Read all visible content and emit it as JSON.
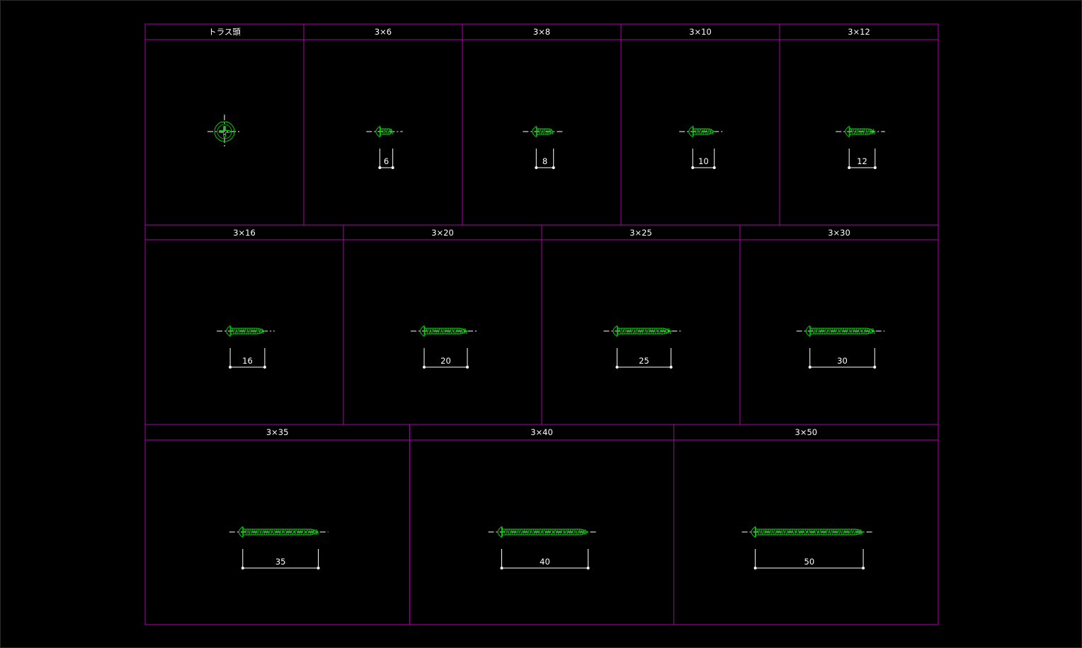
{
  "colors": {
    "background": "#000000",
    "grid": "#b000b0",
    "screw": "#00d000",
    "dimension": "#ffffff",
    "centerline": "#ffffff"
  },
  "title": "トラス頭",
  "rows": [
    {
      "cells": [
        {
          "label": "トラス頭",
          "type": "head-view"
        },
        {
          "label": "3×6",
          "length": 6,
          "dim": "6"
        },
        {
          "label": "3×8",
          "length": 8,
          "dim": "8"
        },
        {
          "label": "3×10",
          "length": 10,
          "dim": "10"
        },
        {
          "label": "3×12",
          "length": 12,
          "dim": "12"
        }
      ]
    },
    {
      "cells": [
        {
          "label": "3×16",
          "length": 16,
          "dim": "16"
        },
        {
          "label": "3×20",
          "length": 20,
          "dim": "20"
        },
        {
          "label": "3×25",
          "length": 25,
          "dim": "25"
        },
        {
          "label": "3×30",
          "length": 30,
          "dim": "30"
        }
      ]
    },
    {
      "cells": [
        {
          "label": "3×35",
          "length": 35,
          "dim": "35"
        },
        {
          "label": "3×40",
          "length": 40,
          "dim": "40"
        },
        {
          "label": "3×50",
          "length": 50,
          "dim": "50"
        }
      ]
    }
  ]
}
